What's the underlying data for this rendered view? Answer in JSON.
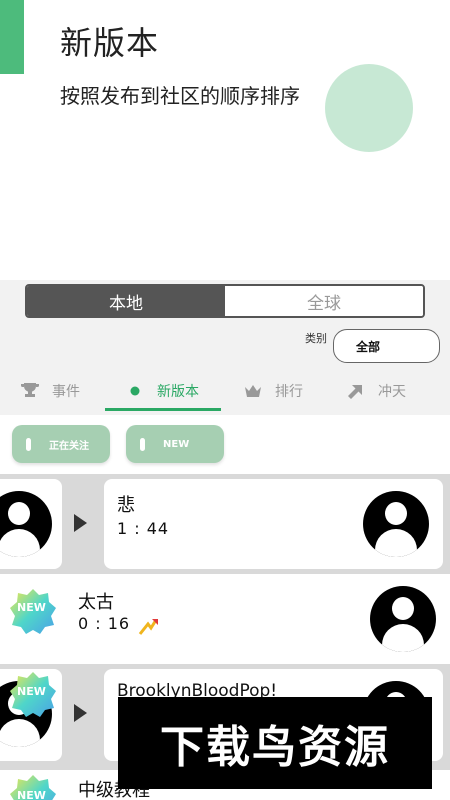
{
  "header": {
    "title": "新版本",
    "subtitle": "按照发布到社区的顺序排序"
  },
  "segmented": {
    "local_label": "本地",
    "global_label": "全球",
    "selected": "local"
  },
  "category": {
    "label": "类别",
    "value": "全部"
  },
  "tabs": [
    {
      "label": "事件",
      "icon": "trophy-icon",
      "active": false
    },
    {
      "label": "新版本",
      "icon": "dot-icon",
      "active": true
    },
    {
      "label": "排行",
      "icon": "crown-icon",
      "active": false
    },
    {
      "label": "冲天",
      "icon": "arrow-up-right-icon",
      "active": false
    }
  ],
  "chips": [
    {
      "label": "正在关注"
    },
    {
      "label": "NEW"
    }
  ],
  "posts": [
    {
      "title": "悲",
      "time": "1 : 44"
    },
    {
      "title": "太古",
      "time": "0 : 16",
      "badge": "NEW"
    },
    {
      "title": "BrooklynBloodPop!",
      "badge": "NEW"
    },
    {
      "title": "中级教程",
      "badge": "NEW"
    }
  ],
  "watermark": "下载鸟资源",
  "colors": {
    "accent": "#4dbb7c",
    "tab_active": "#2aa864",
    "chip": "#a6cfb2",
    "segment_active": "#555555"
  }
}
